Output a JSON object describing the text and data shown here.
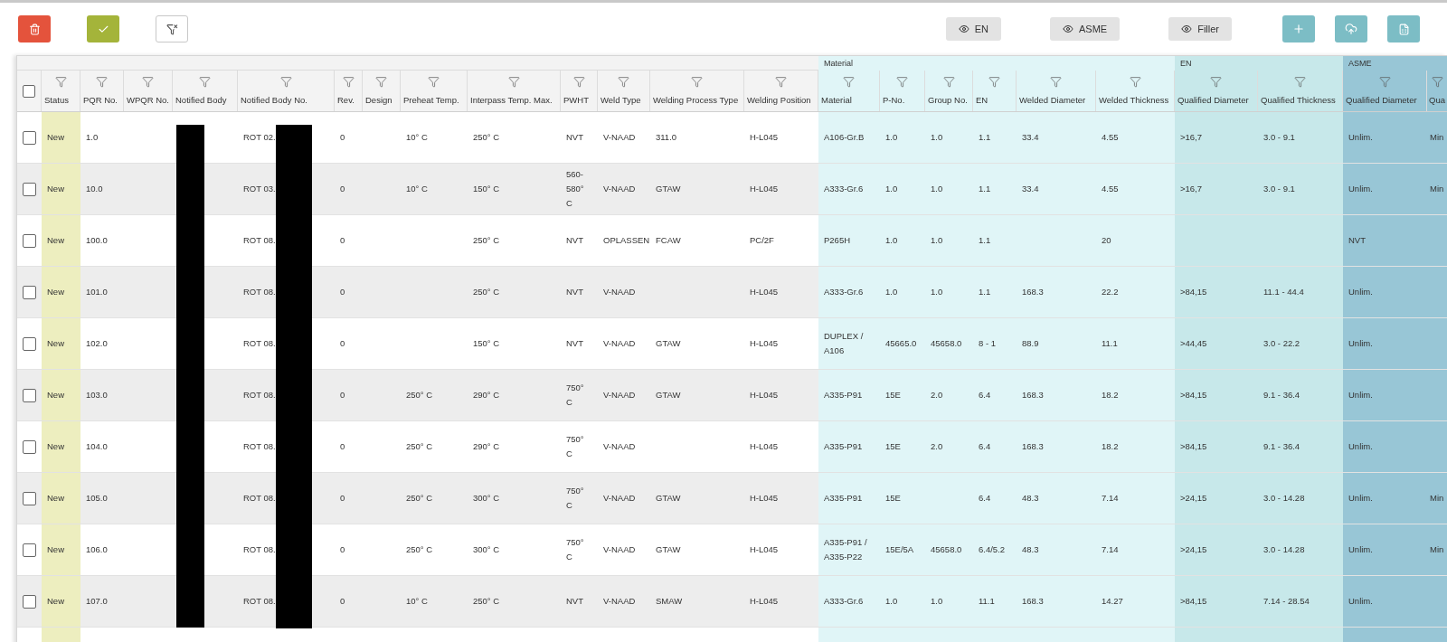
{
  "toolbar": {
    "left_actions": [
      {
        "kind": "delete"
      },
      {
        "kind": "approve"
      },
      {
        "kind": "clear-filter"
      }
    ],
    "view_toggles": [
      {
        "label": "EN"
      },
      {
        "label": "ASME"
      },
      {
        "label": "Filler"
      }
    ],
    "right_actions": [
      {
        "kind": "add"
      },
      {
        "kind": "upload"
      },
      {
        "kind": "export"
      }
    ]
  },
  "table": {
    "select_all": {
      "checked": false
    },
    "columns": [
      "Status",
      "PQR No.",
      "WPQR No.",
      "Notified Body",
      "Notified Body No.",
      "Rev.",
      "Design",
      "Preheat Temp.",
      "Interpass Temp. Max.",
      "PWHT",
      "Weld Type",
      "Welding Process Type",
      "Welding Position"
    ],
    "groups": [
      {
        "label": "Material",
        "color": "#e0f5f7",
        "columns": [
          "Material",
          "P-No.",
          "Group No.",
          "EN",
          "Welded Diameter",
          "Welded Thickness"
        ]
      },
      {
        "label": "EN",
        "color": "#c7e8ea",
        "columns": [
          "Qualified Diameter",
          "Qualified Thickness"
        ]
      },
      {
        "label": "ASME",
        "color": "#98c6d6",
        "columns": [
          "Qualified Diameter",
          "Qua"
        ]
      }
    ],
    "rows": [
      {
        "checked": false,
        "status": "New",
        "pqr_no": "1.0",
        "notified_body_no": "ROT 02.",
        "rev": "0",
        "preheat_temp": "10° C",
        "interpass_temp_max": "250° C",
        "pwht": "NVT",
        "weld_type": "V-NAAD",
        "welding_process_type": "311.0",
        "welding_position": "H-L045",
        "material": "A106-Gr.B",
        "p_no": "1.0",
        "group_no": "1.0",
        "en": "1.1",
        "welded_diameter": "33.4",
        "welded_thickness": "4.55",
        "en_qualified_diameter": ">16,7",
        "en_qualified_thickness": "3.0 - 9.1",
        "asme_qualified_diameter": "Unlim.",
        "asme_column_2": "Min"
      },
      {
        "checked": false,
        "status": "New",
        "pqr_no": "10.0",
        "notified_body_no": "ROT 03.",
        "rev": "0",
        "preheat_temp": "10° C",
        "interpass_temp_max": "150° C",
        "pwht": "560-580° C",
        "weld_type": "V-NAAD",
        "welding_process_type": "GTAW",
        "welding_position": "H-L045",
        "material": "A333-Gr.6",
        "p_no": "1.0",
        "group_no": "1.0",
        "en": "1.1",
        "welded_diameter": "33.4",
        "welded_thickness": "4.55",
        "en_qualified_diameter": ">16,7",
        "en_qualified_thickness": "3.0 - 9.1",
        "asme_qualified_diameter": "Unlim.",
        "asme_column_2": "Min"
      },
      {
        "checked": false,
        "status": "New",
        "pqr_no": "100.0",
        "notified_body_no": "ROT 08.",
        "rev": "0",
        "interpass_temp_max": "250° C",
        "pwht": "NVT",
        "weld_type": "OPLASSEN",
        "welding_process_type": "FCAW",
        "welding_position": "PC/2F",
        "material": "P265H",
        "p_no": "1.0",
        "group_no": "1.0",
        "en": "1.1",
        "welded_thickness": "20",
        "asme_qualified_diameter": "NVT"
      },
      {
        "checked": false,
        "status": "New",
        "pqr_no": "101.0",
        "notified_body_no": "ROT 08.",
        "rev": "0",
        "interpass_temp_max": "250° C",
        "pwht": "NVT",
        "weld_type": "V-NAAD",
        "welding_position": "H-L045",
        "material": "A333-Gr.6",
        "p_no": "1.0",
        "group_no": "1.0",
        "en": "1.1",
        "welded_diameter": "168.3",
        "welded_thickness": "22.2",
        "en_qualified_diameter": ">84,15",
        "en_qualified_thickness": "11.1 - 44.4",
        "asme_qualified_diameter": "Unlim."
      },
      {
        "checked": false,
        "status": "New",
        "pqr_no": "102.0",
        "notified_body_no": "ROT 08.",
        "rev": "0",
        "interpass_temp_max": "150° C",
        "pwht": "NVT",
        "weld_type": "V-NAAD",
        "welding_process_type": "GTAW",
        "welding_position": "H-L045",
        "material": "DUPLEX / A106",
        "p_no": "45665.0",
        "group_no": "45658.0",
        "en": "8 - 1",
        "welded_diameter": "88.9",
        "welded_thickness": "11.1",
        "en_qualified_diameter": ">44,45",
        "en_qualified_thickness": "3.0 - 22.2",
        "asme_qualified_diameter": "Unlim."
      },
      {
        "checked": false,
        "status": "New",
        "pqr_no": "103.0",
        "notified_body_no": "ROT 08.",
        "rev": "0",
        "preheat_temp": "250° C",
        "interpass_temp_max": "290° C",
        "pwht": "750° C",
        "weld_type": "V-NAAD",
        "welding_process_type": "GTAW",
        "welding_position": "H-L045",
        "material": "A335-P91",
        "p_no": "15E",
        "group_no": "2.0",
        "en": "6.4",
        "welded_diameter": "168.3",
        "welded_thickness": "18.2",
        "en_qualified_diameter": ">84,15",
        "en_qualified_thickness": "9.1 - 36.4",
        "asme_qualified_diameter": "Unlim."
      },
      {
        "checked": false,
        "status": "New",
        "pqr_no": "104.0",
        "notified_body_no": "ROT 08.",
        "rev": "0",
        "preheat_temp": "250° C",
        "interpass_temp_max": "290° C",
        "pwht": "750° C",
        "weld_type": "V-NAAD",
        "welding_position": "H-L045",
        "material": "A335-P91",
        "p_no": "15E",
        "group_no": "2.0",
        "en": "6.4",
        "welded_diameter": "168.3",
        "welded_thickness": "18.2",
        "en_qualified_diameter": ">84,15",
        "en_qualified_thickness": "9.1 - 36.4",
        "asme_qualified_diameter": "Unlim."
      },
      {
        "checked": false,
        "status": "New",
        "pqr_no": "105.0",
        "notified_body_no": "ROT 08.",
        "rev": "0",
        "preheat_temp": "250° C",
        "interpass_temp_max": "300° C",
        "pwht": "750° C",
        "weld_type": "V-NAAD",
        "welding_process_type": "GTAW",
        "welding_position": "H-L045",
        "material": "A335-P91",
        "p_no": "15E",
        "en": "6.4",
        "welded_diameter": "48.3",
        "welded_thickness": "7.14",
        "en_qualified_diameter": ">24,15",
        "en_qualified_thickness": "3.0 - 14.28",
        "asme_qualified_diameter": "Unlim.",
        "asme_column_2": "Min"
      },
      {
        "checked": false,
        "status": "New",
        "pqr_no": "106.0",
        "notified_body_no": "ROT 08.",
        "rev": "0",
        "preheat_temp": "250° C",
        "interpass_temp_max": "300° C",
        "pwht": "750° C",
        "weld_type": "V-NAAD",
        "welding_process_type": "GTAW",
        "welding_position": "H-L045",
        "material": "A335-P91 / A335-P22",
        "p_no": "15E/5A",
        "group_no": "45658.0",
        "en": "6.4/5.2",
        "welded_diameter": "48.3",
        "welded_thickness": "7.14",
        "en_qualified_diameter": ">24,15",
        "en_qualified_thickness": "3.0 - 14.28",
        "asme_qualified_diameter": "Unlim.",
        "asme_column_2": "Min"
      },
      {
        "checked": false,
        "status": "New",
        "pqr_no": "107.0",
        "notified_body_no": "ROT 08.",
        "rev": "0",
        "preheat_temp": "10° C",
        "interpass_temp_max": "250° C",
        "pwht": "NVT",
        "weld_type": "V-NAAD",
        "welding_process_type": "SMAW",
        "welding_position": "H-L045",
        "material": "A333-Gr.6",
        "p_no": "1.0",
        "group_no": "1.0",
        "en": "11.1",
        "welded_diameter": "168.3",
        "welded_thickness": "14.27",
        "en_qualified_diameter": ">84,15",
        "en_qualified_thickness": "7.14 - 28.54",
        "asme_qualified_diameter": "Unlim."
      }
    ]
  }
}
